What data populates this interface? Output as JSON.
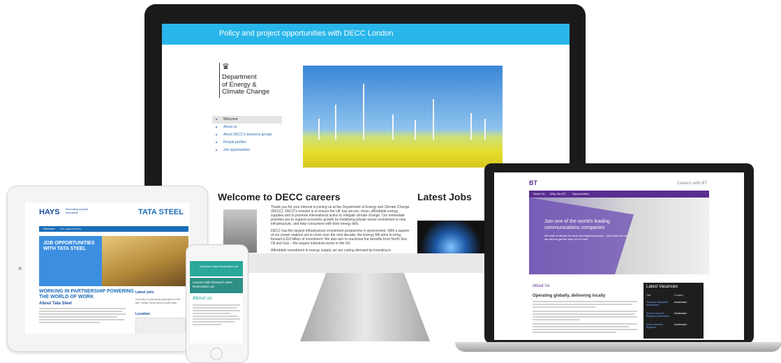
{
  "desktop": {
    "banner": "Policy and project opportunities with DECC London",
    "org_name": "Department\nof Energy &\nClimate Change",
    "nav": [
      "Welcome",
      "About us",
      "About DECC's business groups",
      "People profiles",
      "Job opportunities"
    ],
    "welcome_title": "Welcome to DECC careers",
    "latest_jobs_title": "Latest Jobs",
    "para1": "Thank you for your interest in joining us at the Department of Energy and Climate Change (DECC). DECC's mission is to ensure the UK has secure, clean, affordable energy supplies and to promote international action to mitigate climate change. Our immediate priorities are to support economic growth by mobilising private sector investment in new infrastructure, and help consumers with their energy bills.",
    "para2": "DECC has the largest infrastructure investment programme in government. With a quarter of our power stations set to close over the next decade, the Energy Bill aims to bring forward £110 billion of investment. We also aim to maximise the benefits from North Sea Oil and Gas – the largest industrial sector in the UK.",
    "para3": "Affordable investment in energy supply, we are cutting demand by investing in"
  },
  "tablet": {
    "hays": "HAYS",
    "hays_tagline": "Recruiting experts worldwide",
    "tata": "TATA STEEL",
    "nav": [
      "Welcome",
      "Job opportunities"
    ],
    "job_box": "JOB OPPORTUNITIES WITH TATA STEEL",
    "heading": "WORKING IN PARTNERSHIP POWERING THE WORLD OF WORK",
    "about": "About Tata Steel",
    "latest_jobs": "Latest jobs",
    "latest_jobs_text": "Currently no jobs being advertised for this site. Please check back at a later date.",
    "location": "Location"
  },
  "phone": {
    "header": "Research Sites Restoration Ltd",
    "band": "Careers with Research Sites Restoration Ltd",
    "about": "About us"
  },
  "laptop": {
    "logo": "BT",
    "careers": "Careers with BT",
    "nav": [
      "About Us",
      "Why Join BT",
      "Opportunities"
    ],
    "hero_title": "Join one of the world's leading communications companies",
    "hero_sub": "We want to attract the best and brightest people – just when we do, we want to get the best out of them.",
    "about": "About Us",
    "op_title": "Operating globally, delivering locally",
    "vacancies_title": "Latest Vacancies",
    "vac_headers": [
      "Title",
      "Location"
    ],
    "vacancies": [
      {
        "role": "Technical Specialist Amsterdam",
        "location": "Amsterdam"
      },
      {
        "role": "Service Account Engineer Amsterdam",
        "location": "Amsterdam"
      },
      {
        "role": "Senior Network Engineer",
        "location": "Amsterdam"
      }
    ]
  }
}
